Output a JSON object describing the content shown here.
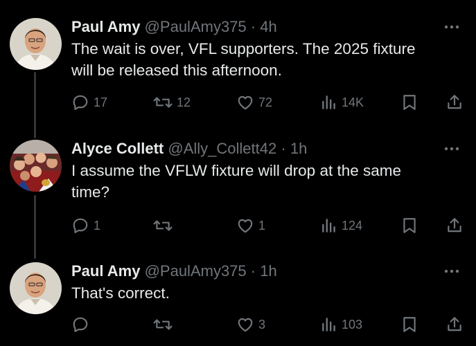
{
  "colors": {
    "background": "#000000",
    "text": "#e7e9ea",
    "muted": "#71767b",
    "thread_line": "#333639"
  },
  "tweets": [
    {
      "name": "Paul Amy",
      "handle": "@PaulAmy375",
      "dot": "·",
      "time": "4h",
      "text_lines": [
        "The wait is over, VFL supporters. The 2025 fixture",
        "will be released this afternoon."
      ],
      "replies": "17",
      "reposts": "12",
      "likes": "72",
      "views": "14K",
      "avatar": "man-portrait-avatar"
    },
    {
      "name": "Alyce Collett",
      "handle": "@Ally_Collett42",
      "dot": "·",
      "time": "1h",
      "text_lines": [
        "I assume the VFLW fixture will drop at the same",
        "time?"
      ],
      "replies": "1",
      "reposts": "",
      "likes": "1",
      "views": "124",
      "avatar": "group-photo-avatar"
    },
    {
      "name": "Paul Amy",
      "handle": "@PaulAmy375",
      "dot": "·",
      "time": "1h",
      "text_lines": [
        "That's correct."
      ],
      "replies": "",
      "reposts": "",
      "likes": "3",
      "views": "103",
      "avatar": "man-portrait-avatar"
    }
  ]
}
